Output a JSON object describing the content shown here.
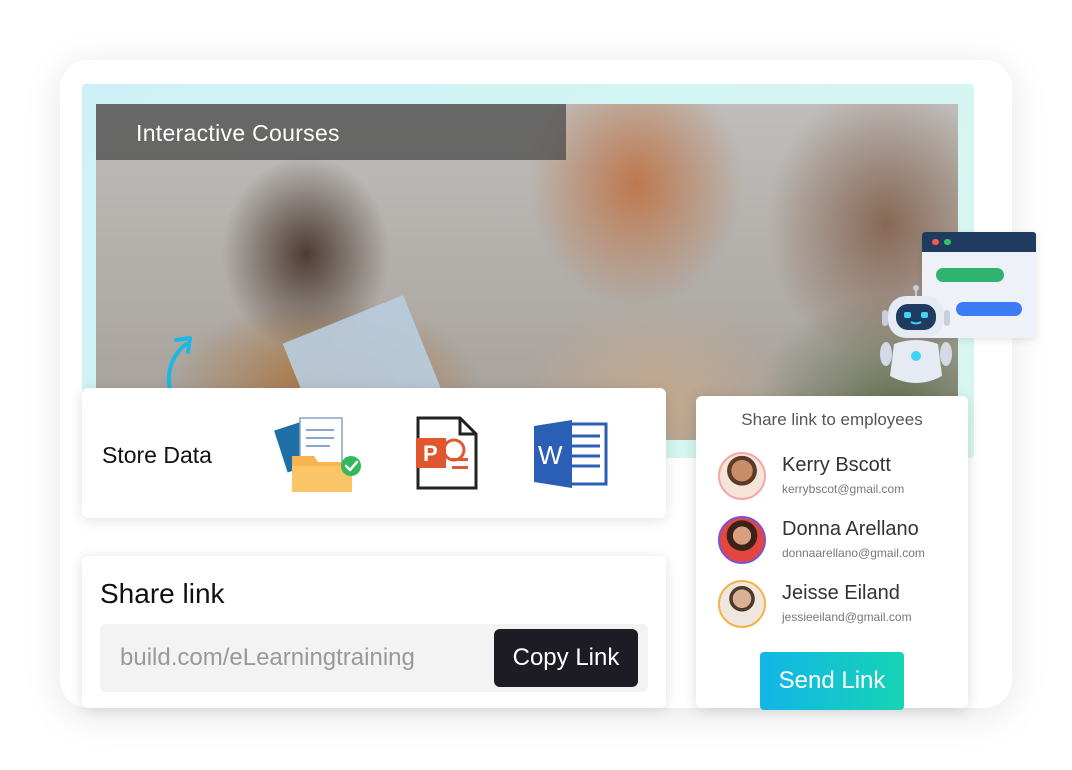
{
  "hero": {
    "title": "Interactive Courses"
  },
  "store": {
    "label": "Store Data",
    "file_icons": [
      "folder-files-icon",
      "powerpoint-icon",
      "word-icon"
    ],
    "powerpoint_letter": "P",
    "word_letter": "W"
  },
  "share": {
    "title": "Share link",
    "link_value": "build.com/eLearningtraining",
    "copy_button": "Copy Link"
  },
  "employees": {
    "header": "Share link to employees",
    "people": [
      {
        "name": "Kerry Bscott",
        "email": "kerrybscot@gmail.com",
        "ring_color": "#f0a9a4"
      },
      {
        "name": "Donna Arellano",
        "email": "donnaarellano@gmail.com",
        "ring_color": "#7a54d8"
      },
      {
        "name": "Jeisse Eiland",
        "email": "jessieeiland@gmail.com",
        "ring_color": "#f2b347"
      }
    ],
    "send_button": "Send Link"
  },
  "colors": {
    "accent_gradient_start": "#12b6e8",
    "accent_gradient_end": "#16d3b4",
    "dark_button": "#1d1c24",
    "chat_green": "#2fb36f",
    "chat_blue": "#3d7bf5"
  }
}
